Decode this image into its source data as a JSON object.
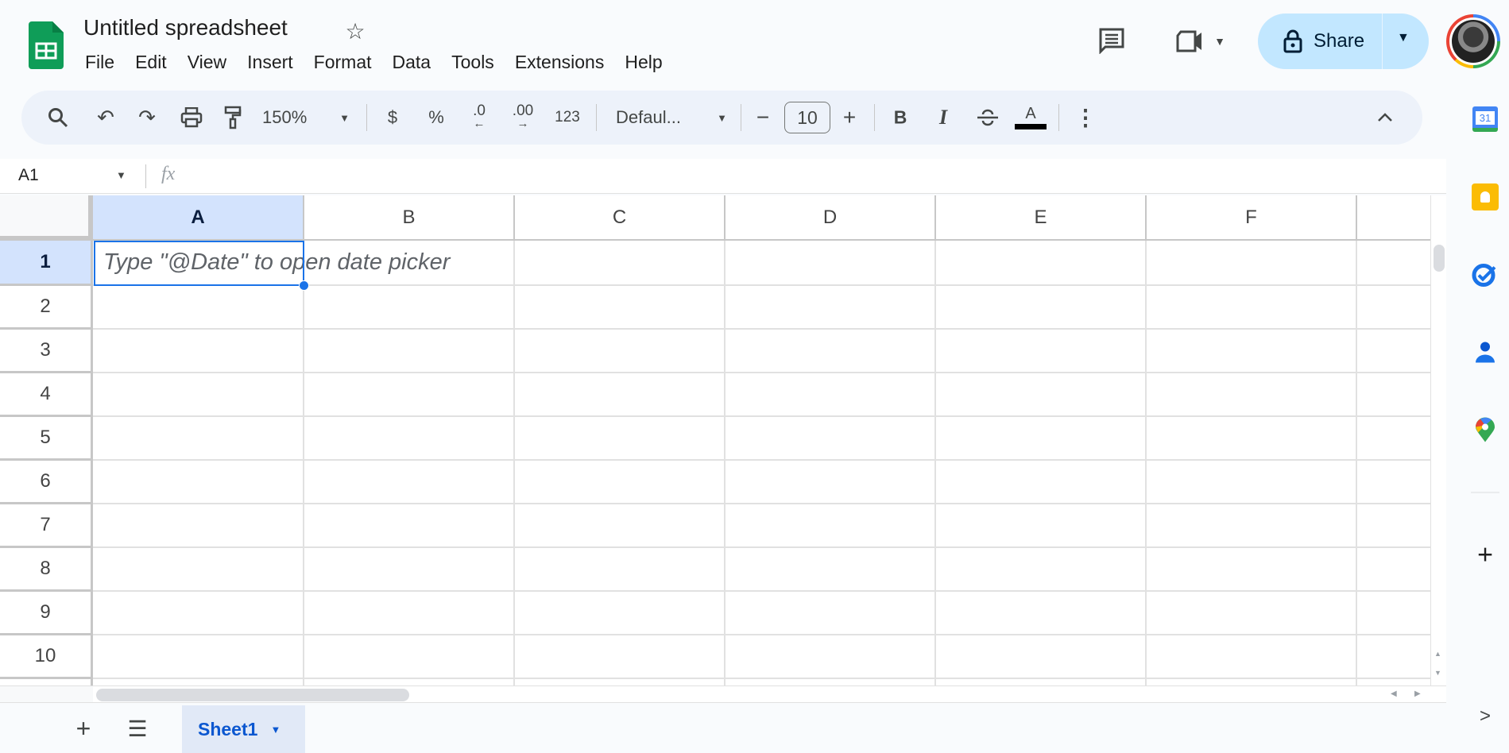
{
  "app": {
    "title": "Untitled spreadsheet",
    "menu": [
      "File",
      "Edit",
      "View",
      "Insert",
      "Format",
      "Data",
      "Tools",
      "Extensions",
      "Help"
    ],
    "share_label": "Share",
    "accent": "#0b57d0",
    "share_bg": "#c2e7ff"
  },
  "toolbar": {
    "zoom": "150%",
    "currency": "$",
    "percent": "%",
    "dec_decrease": ".0",
    "dec_increase": ".00",
    "number_format": "123",
    "font": "Defaul...",
    "font_size": "10",
    "bold": "B",
    "italic": "I",
    "text_color": "A"
  },
  "formula_bar": {
    "cell_ref": "A1",
    "fx": "fx",
    "value": ""
  },
  "grid": {
    "columns": [
      "A",
      "B",
      "C",
      "D",
      "E",
      "F"
    ],
    "rows": [
      "1",
      "2",
      "3",
      "4",
      "5",
      "6",
      "7",
      "8",
      "9",
      "10"
    ],
    "selected_cell": "A1",
    "a1_hint": "Type \"@Date\" to open date picker"
  },
  "sheets": {
    "tabs": [
      {
        "label": "Sheet1",
        "active": true
      }
    ]
  },
  "side_panel": {
    "calendar_day": "31",
    "icons": [
      "calendar-icon",
      "keep-icon",
      "tasks-icon",
      "contacts-icon",
      "maps-icon",
      "add-icon",
      "expand-icon"
    ]
  }
}
